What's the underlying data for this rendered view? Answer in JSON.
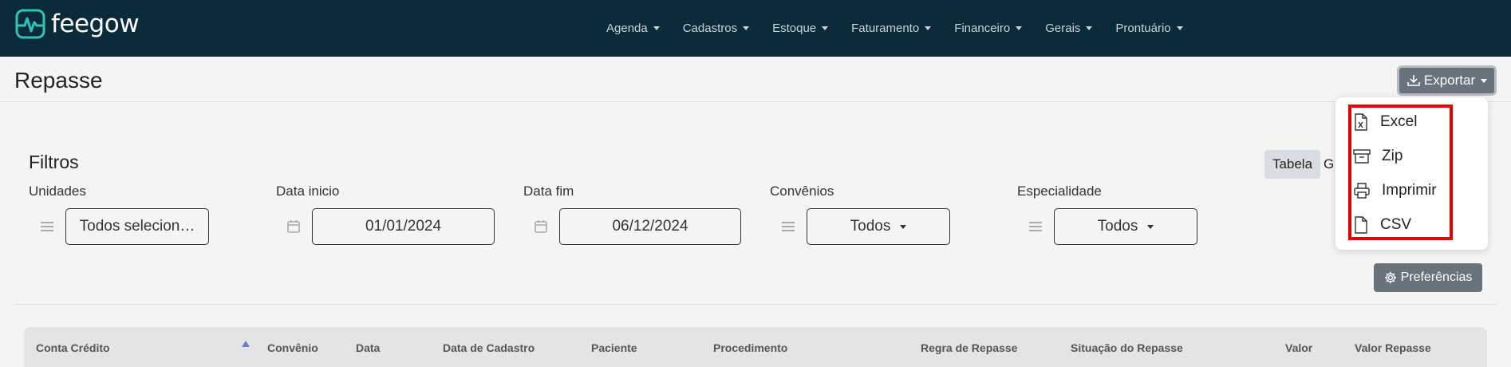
{
  "brand": {
    "name": "feegow",
    "accent": "#2ec4b6",
    "navbar_bg": "#0c2b3a"
  },
  "nav": {
    "items": [
      {
        "label": "Agenda"
      },
      {
        "label": "Cadastros"
      },
      {
        "label": "Estoque"
      },
      {
        "label": "Faturamento"
      },
      {
        "label": "Financeiro"
      },
      {
        "label": "Gerais"
      },
      {
        "label": "Prontuário"
      }
    ]
  },
  "page": {
    "title": "Repasse"
  },
  "export": {
    "label": "Exportar",
    "icon": "download-icon",
    "menu": [
      {
        "label": "Excel",
        "icon": "excel-file-icon"
      },
      {
        "label": "Zip",
        "icon": "archive-icon"
      },
      {
        "label": "Imprimir",
        "icon": "printer-icon"
      },
      {
        "label": "CSV",
        "icon": "file-icon"
      }
    ],
    "highlight_color": "#e60000"
  },
  "filters": {
    "title": "Filtros",
    "unidades": {
      "label": "Unidades",
      "value": "Todos selecion…",
      "icon": "list-icon"
    },
    "data_inicio": {
      "label": "Data inicio",
      "value": "01/01/2024",
      "icon": "calendar-icon"
    },
    "data_fim": {
      "label": "Data fim",
      "value": "06/12/2024",
      "icon": "calendar-icon"
    },
    "convenios": {
      "label": "Convênios",
      "value": "Todos",
      "icon": "list-icon"
    },
    "especialidade": {
      "label": "Especialidade",
      "value": "Todos",
      "icon": "list-icon"
    }
  },
  "view_toggle": {
    "tabela": "Tabela",
    "other": "G"
  },
  "preferences": {
    "label": "Preferências",
    "icon": "gear-icon"
  },
  "table": {
    "columns": [
      "Conta Crédito",
      "Convênio",
      "Data",
      "Data de Cadastro",
      "Paciente",
      "Procedimento",
      "Regra de Repasse",
      "Situação do Repasse",
      "Valor",
      "Valor Repasse"
    ],
    "sorted_column": "Conta Crédito",
    "sort_direction": "asc"
  }
}
